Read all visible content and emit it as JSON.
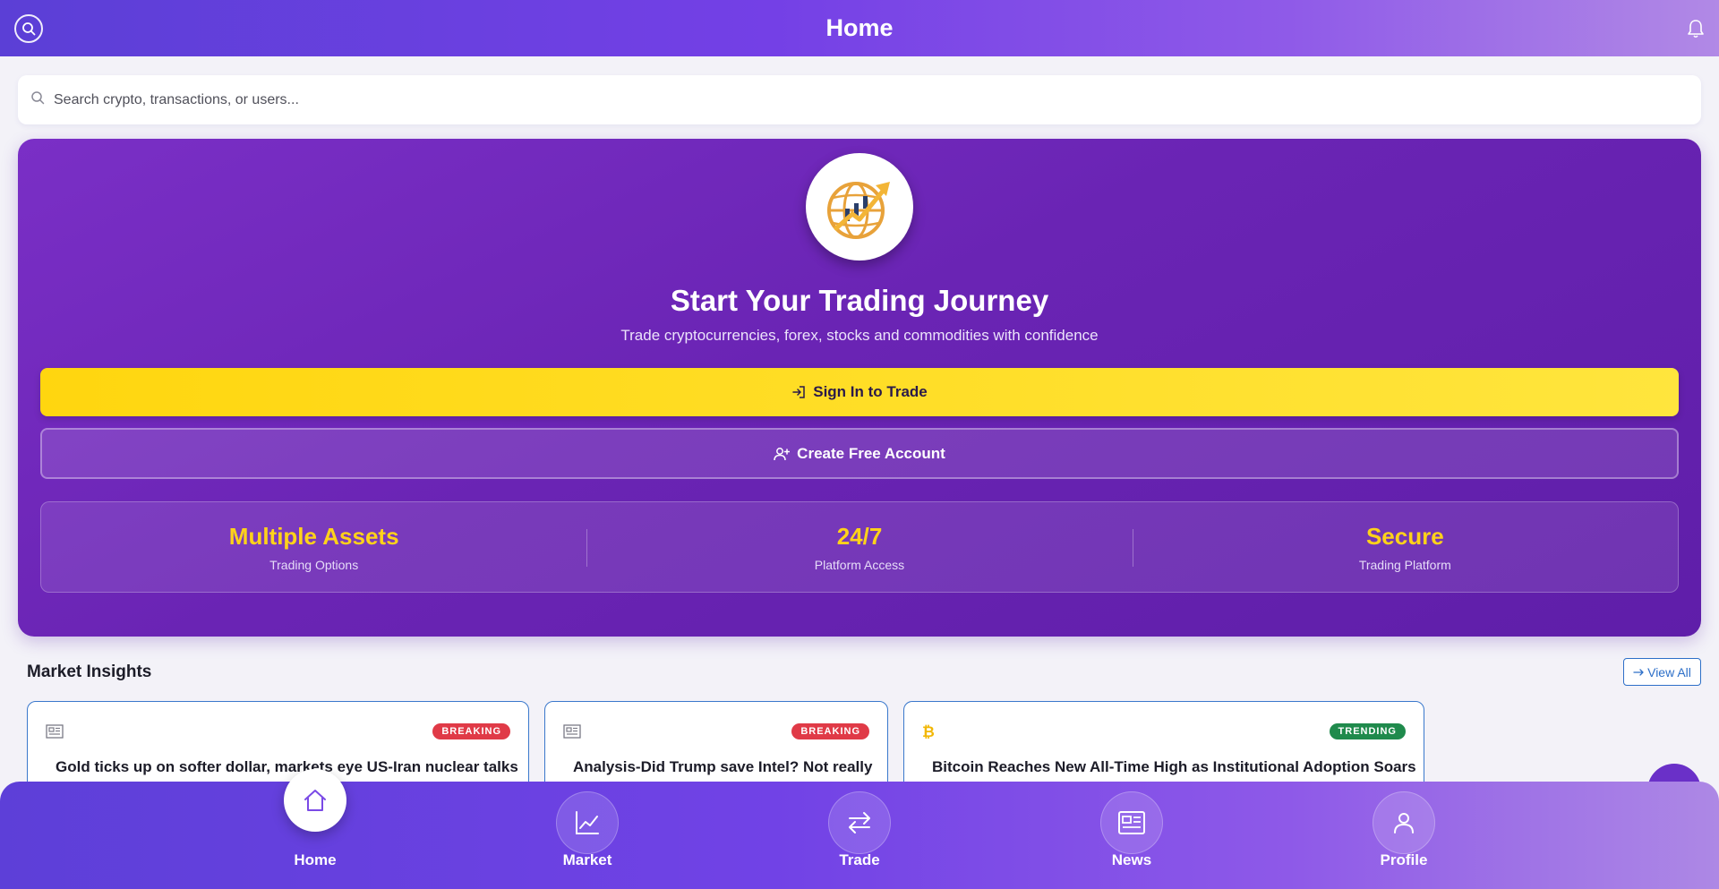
{
  "header": {
    "title": "Home"
  },
  "search": {
    "placeholder": "Search crypto, transactions, or users..."
  },
  "hero": {
    "title": "Start Your Trading Journey",
    "subtitle": "Trade cryptocurrencies, forex, stocks and commodities with confidence",
    "signin_label": "Sign In to Trade",
    "create_label": "Create Free Account",
    "stats": [
      {
        "value": "Multiple Assets",
        "label": "Trading Options"
      },
      {
        "value": "24/7",
        "label": "Platform Access"
      },
      {
        "value": "Secure",
        "label": "Trading Platform"
      }
    ]
  },
  "insights": {
    "title": "Market Insights",
    "view_all_label": "View All",
    "cards": [
      {
        "badge": "BREAKING",
        "title": "Gold ticks up on softer dollar, markets eye US-Iran nuclear talks",
        "icon": "newspaper-icon",
        "badge_color": "#e03a47"
      },
      {
        "badge": "BREAKING",
        "title": "Analysis-Did Trump save Intel? Not really",
        "icon": "newspaper-icon",
        "badge_color": "#e03a47"
      },
      {
        "badge": "TRENDING",
        "title": "Bitcoin Reaches New All-Time High as Institutional Adoption Soars",
        "icon": "bitcoin-icon",
        "badge_color": "#1f8a4c"
      }
    ]
  },
  "nav": {
    "items": [
      {
        "label": "Home",
        "icon": "home-icon",
        "active": true
      },
      {
        "label": "Market",
        "icon": "chart-line-icon",
        "active": false
      },
      {
        "label": "Trade",
        "icon": "exchange-arrows-icon",
        "active": false
      },
      {
        "label": "News",
        "icon": "newspaper-icon",
        "active": false
      },
      {
        "label": "Profile",
        "icon": "user-icon",
        "active": false
      }
    ]
  },
  "colors": {
    "accent": "#7440e6",
    "hero_bg": "#6a24b4",
    "signin_button": "#ffd60f",
    "stat_value": "#ffd21a",
    "link_blue": "#2d6fc8"
  }
}
